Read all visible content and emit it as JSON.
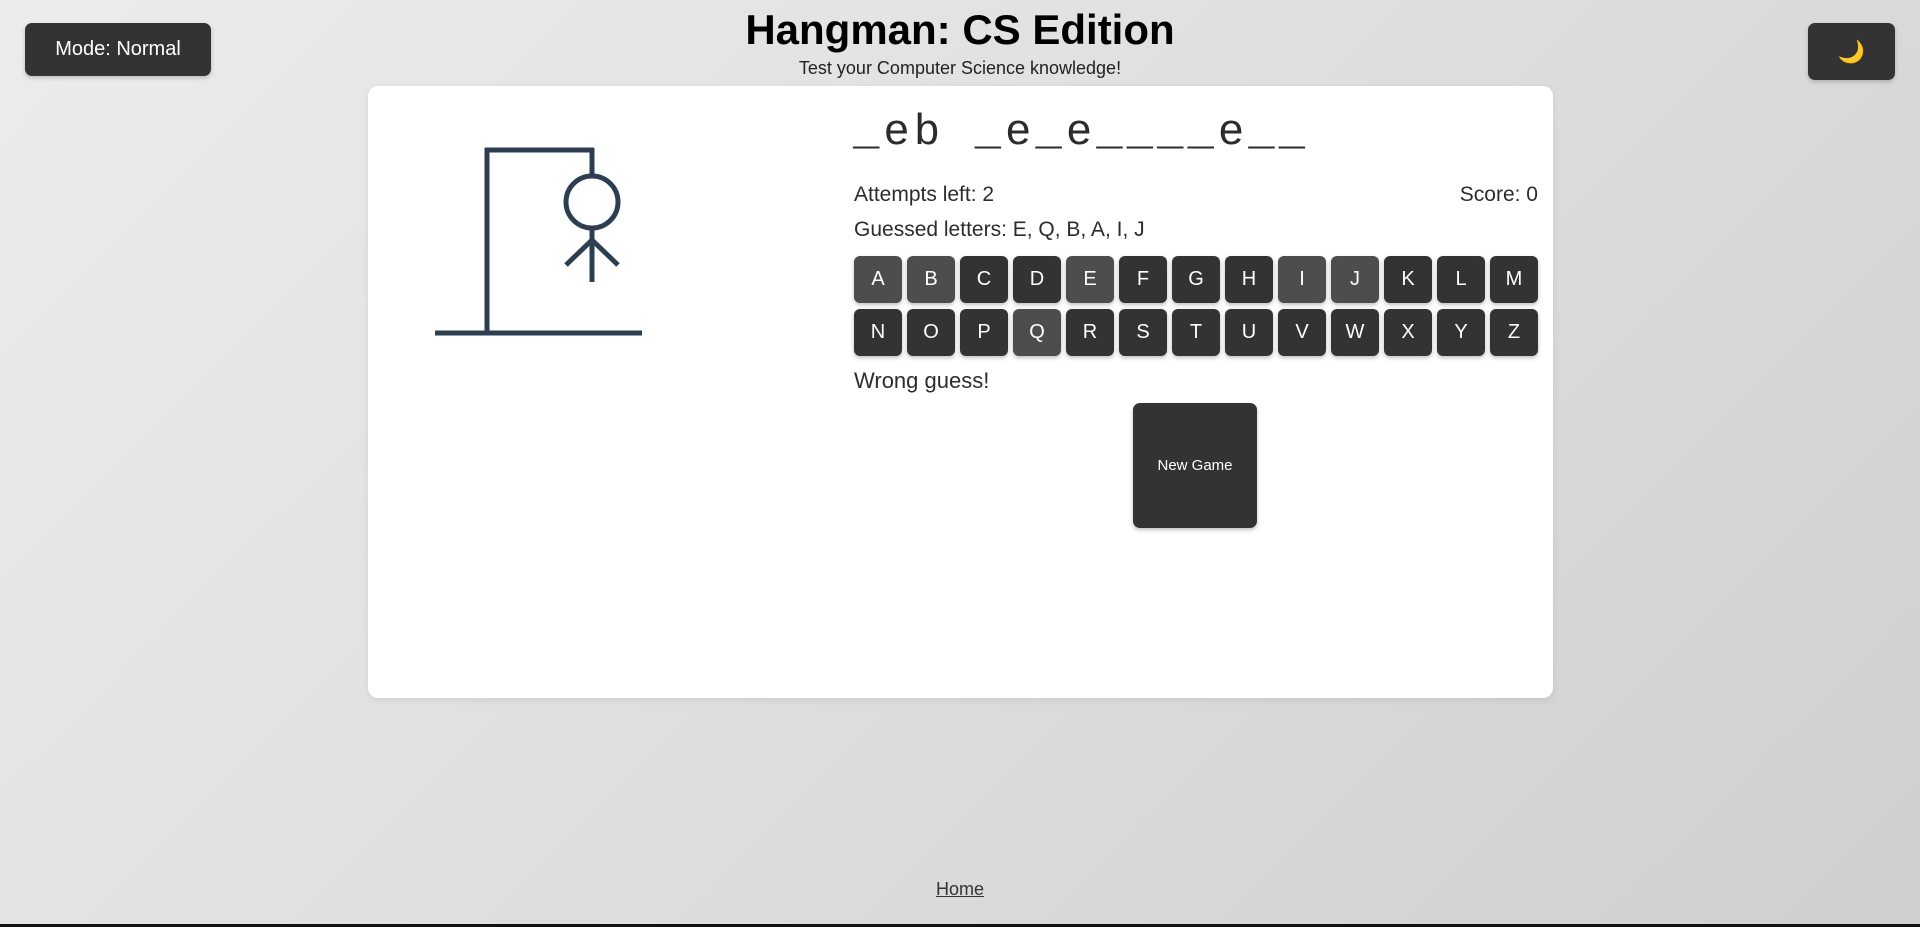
{
  "mode_button": {
    "label": "Mode: Normal"
  },
  "theme_button": {
    "icon": "moon-icon",
    "glyph": "🌙"
  },
  "header": {
    "title": "Hangman: CS Edition",
    "subtitle": "Test your Computer Science knowledge!"
  },
  "game": {
    "word_display": "_eb _e_e____e__",
    "attempts_label": "Attempts left: 2",
    "score_label": "Score: 0",
    "guessed_label": "Guessed letters: E, Q, B, A, I, J",
    "message": "Wrong guess!",
    "new_game_label": "New Game",
    "keys": [
      {
        "letter": "A",
        "used": true
      },
      {
        "letter": "B",
        "used": true
      },
      {
        "letter": "C",
        "used": false
      },
      {
        "letter": "D",
        "used": false
      },
      {
        "letter": "E",
        "used": true
      },
      {
        "letter": "F",
        "used": false
      },
      {
        "letter": "G",
        "used": false
      },
      {
        "letter": "H",
        "used": false
      },
      {
        "letter": "I",
        "used": true
      },
      {
        "letter": "J",
        "used": true
      },
      {
        "letter": "K",
        "used": false
      },
      {
        "letter": "L",
        "used": false
      },
      {
        "letter": "M",
        "used": false
      },
      {
        "letter": "N",
        "used": false
      },
      {
        "letter": "O",
        "used": false
      },
      {
        "letter": "P",
        "used": false
      },
      {
        "letter": "Q",
        "used": true
      },
      {
        "letter": "R",
        "used": false
      },
      {
        "letter": "S",
        "used": false
      },
      {
        "letter": "T",
        "used": false
      },
      {
        "letter": "U",
        "used": false
      },
      {
        "letter": "V",
        "used": false
      },
      {
        "letter": "W",
        "used": false
      },
      {
        "letter": "X",
        "used": false
      },
      {
        "letter": "Y",
        "used": false
      },
      {
        "letter": "Z",
        "used": false
      }
    ]
  },
  "footer": {
    "home_label": "Home"
  },
  "colors": {
    "button_bg": "#333333",
    "button_used_bg": "#4d4d4d",
    "hangman_stroke": "#2c3e50",
    "card_bg": "#ffffff"
  }
}
